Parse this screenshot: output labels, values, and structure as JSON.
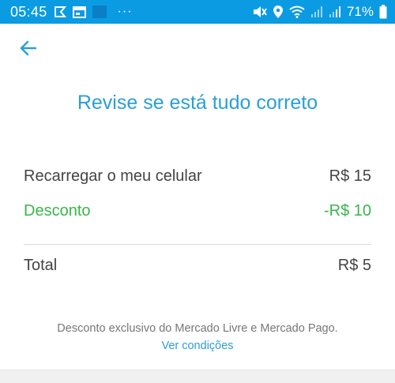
{
  "status_bar": {
    "time": "05:45",
    "battery_text": "71%",
    "left_icons": [
      "flag-icon",
      "window-icon",
      "thumbnail-icon",
      "more-dots-icon"
    ],
    "right_icons": [
      "mute-icon",
      "location-icon",
      "wifi-icon",
      "signal-icon",
      "signal-icon",
      "battery-icon"
    ],
    "more_dots": "···"
  },
  "header": {
    "back_icon": "arrow-left-icon"
  },
  "review": {
    "title": "Revise se está tudo correto",
    "items": [
      {
        "label": "Recarregar o meu celular",
        "value": "R$ 15"
      },
      {
        "label": "Desconto",
        "value": "-R$ 10"
      }
    ],
    "total": {
      "label": "Total",
      "value": "R$ 5"
    }
  },
  "footer": {
    "note": "Desconto exclusivo do Mercado Livre e Mercado Pago.",
    "link": "Ver condições"
  },
  "colors": {
    "status_bar": "#0a9be3",
    "accent": "#2a9fd6",
    "discount": "#39b54a",
    "text": "#444444"
  }
}
